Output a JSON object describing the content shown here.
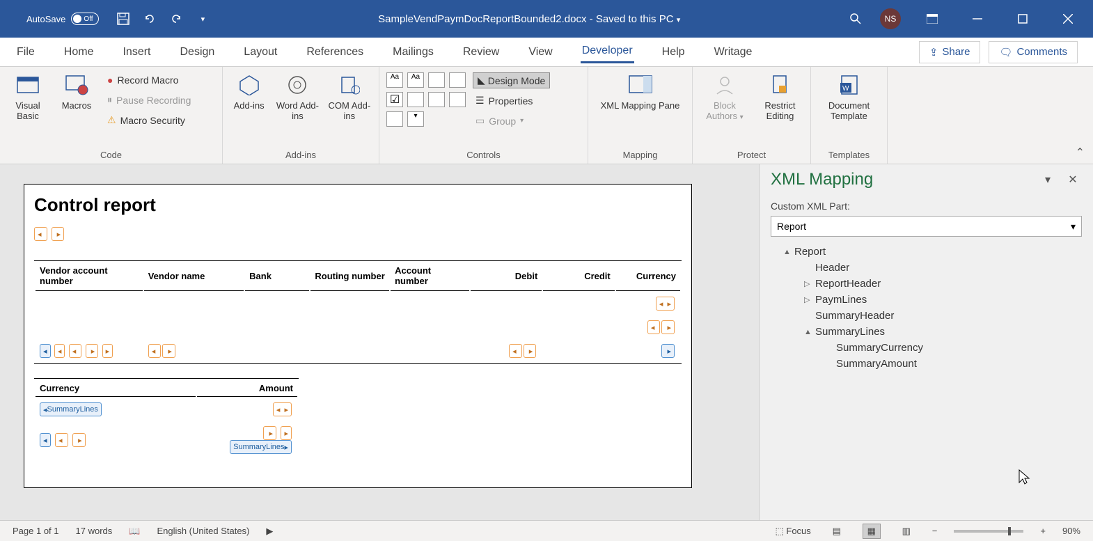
{
  "titlebar": {
    "autosave_label": "AutoSave",
    "autosave_state": "Off",
    "filename": "SampleVendPaymDocReportBounded2.docx",
    "save_status": "Saved to this PC",
    "user_initials": "NS"
  },
  "tabs": {
    "items": [
      "File",
      "Home",
      "Insert",
      "Design",
      "Layout",
      "References",
      "Mailings",
      "Review",
      "View",
      "Developer",
      "Help",
      "Writage"
    ],
    "active": "Developer",
    "share": "Share",
    "comments": "Comments"
  },
  "ribbon": {
    "code": {
      "visual_basic": "Visual Basic",
      "macros": "Macros",
      "record_macro": "Record Macro",
      "pause_recording": "Pause Recording",
      "macro_security": "Macro Security",
      "group": "Code"
    },
    "addins": {
      "addins": "Add-ins",
      "word_addins": "Word Add-ins",
      "com_addins": "COM Add-ins",
      "group": "Add-ins"
    },
    "controls": {
      "design_mode": "Design Mode",
      "properties": "Properties",
      "group_btn": "Group",
      "group": "Controls"
    },
    "mapping": {
      "xml_mapping_pane": "XML Mapping Pane",
      "group": "Mapping"
    },
    "protect": {
      "block_authors": "Block Authors",
      "restrict_editing": "Restrict Editing",
      "group": "Protect"
    },
    "templates": {
      "document_template": "Document Template",
      "group": "Templates"
    }
  },
  "document": {
    "title": "Control report",
    "table1_headers": [
      "Vendor account number",
      "Vendor name",
      "Bank",
      "Routing number",
      "Account number",
      "Debit",
      "Credit",
      "Currency"
    ],
    "table2_headers": [
      "Currency",
      "Amount"
    ],
    "cc_summarylines": "SummaryLines"
  },
  "pane": {
    "title": "XML Mapping",
    "label": "Custom XML Part:",
    "selected": "Report",
    "tree": {
      "root": "Report",
      "children": [
        "Header",
        "ReportHeader",
        "PaymLines",
        "SummaryHeader",
        "SummaryLines"
      ],
      "summary_children": [
        "SummaryCurrency",
        "SummaryAmount"
      ]
    }
  },
  "status": {
    "page": "Page 1 of 1",
    "words": "17 words",
    "language": "English (United States)",
    "focus": "Focus",
    "zoom": "90%"
  }
}
